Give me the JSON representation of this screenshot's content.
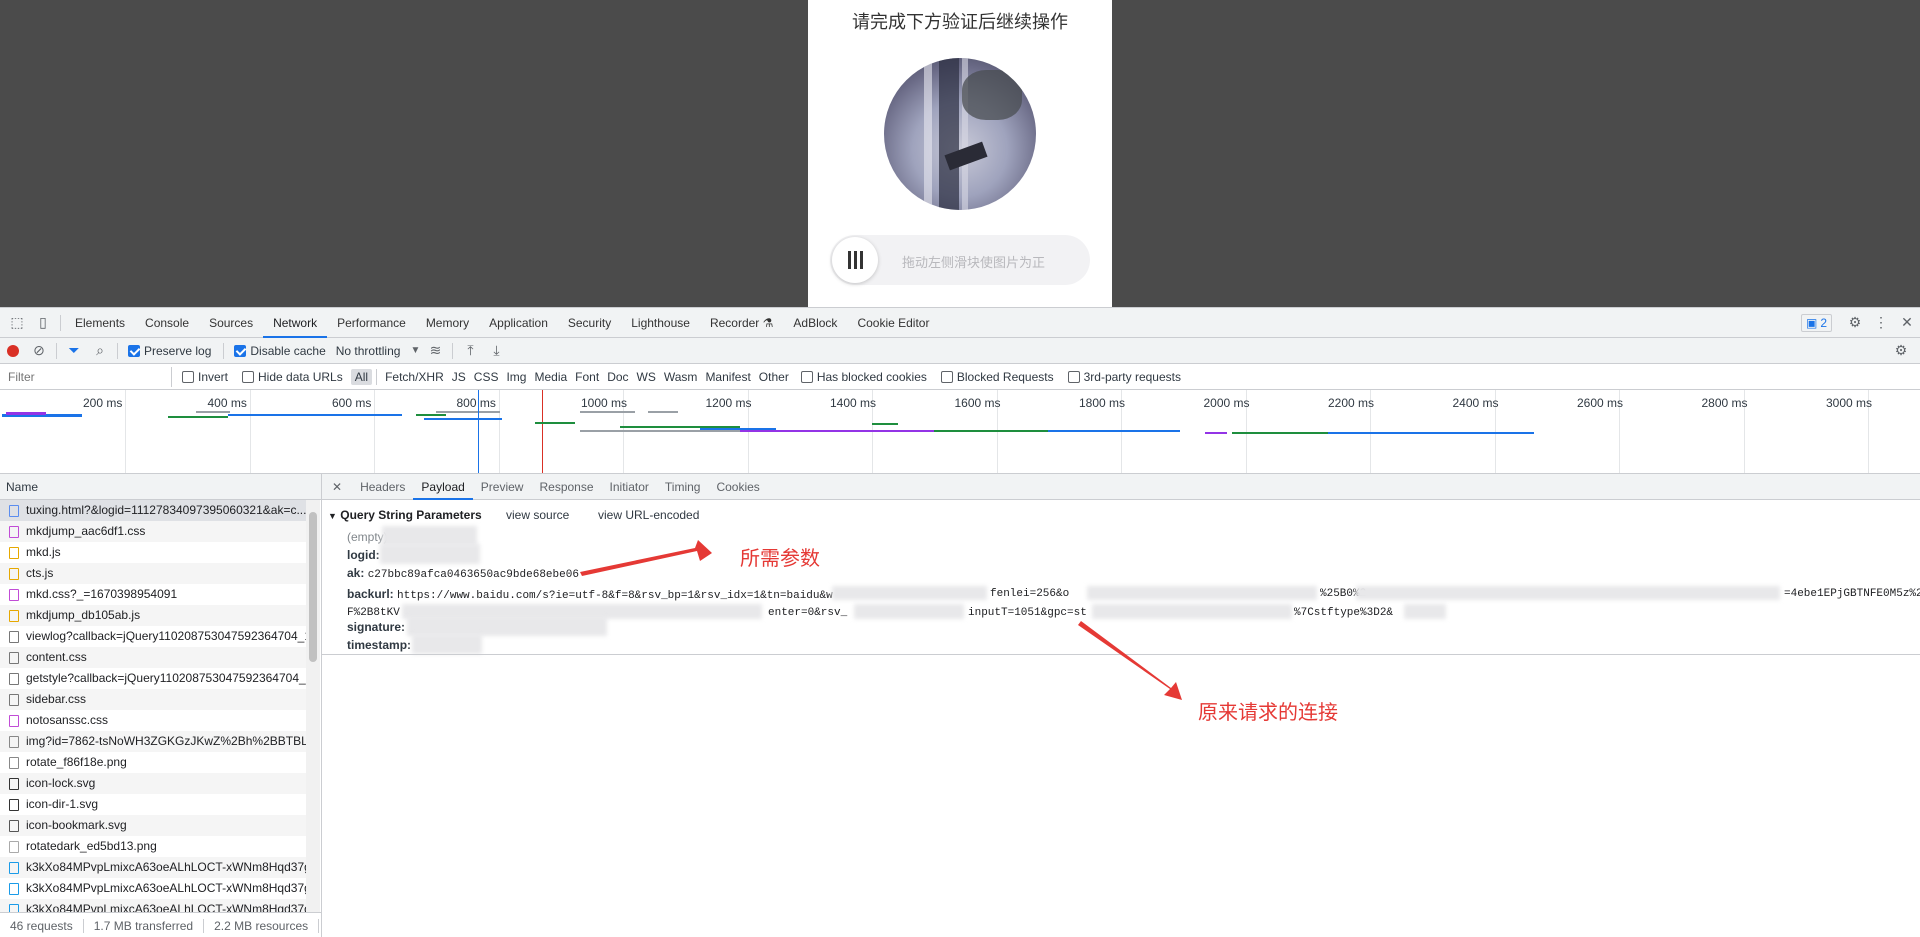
{
  "captcha": {
    "title": "请完成下方验证后继续操作",
    "slider_hint": "拖动左侧滑块使图片为正"
  },
  "devtools": {
    "main_tabs": [
      "Elements",
      "Console",
      "Sources",
      "Network",
      "Performance",
      "Memory",
      "Application",
      "Security",
      "Lighthouse",
      "Recorder ⚗",
      "AdBlock",
      "Cookie Editor"
    ],
    "active_tab": "Network",
    "issues_count": "2",
    "toolbar": {
      "preserve_log": "Preserve log",
      "disable_cache": "Disable cache",
      "throttling": "No throttling"
    },
    "filter": {
      "placeholder": "Filter",
      "invert": "Invert",
      "hide_data_urls": "Hide data URLs",
      "types": [
        "All",
        "Fetch/XHR",
        "JS",
        "CSS",
        "Img",
        "Media",
        "Font",
        "Doc",
        "WS",
        "Wasm",
        "Manifest",
        "Other"
      ],
      "has_blocked_cookies": "Has blocked cookies",
      "blocked_requests": "Blocked Requests",
      "third_party": "3rd-party requests"
    },
    "timeline_ticks": [
      "200 ms",
      "400 ms",
      "600 ms",
      "800 ms",
      "1000 ms",
      "1200 ms",
      "1400 ms",
      "1600 ms",
      "1800 ms",
      "2000 ms",
      "2200 ms",
      "2400 ms",
      "2600 ms",
      "2800 ms",
      "3000 ms"
    ],
    "name_header": "Name",
    "requests": [
      "tuxing.html?&logid=11127834097395060321&ak=c...",
      "mkdjump_aac6df1.css",
      "mkd.js",
      "cts.js",
      "mkd.css?_=1670398954091",
      "mkdjump_db105ab.js",
      "viewlog?callback=jQuery110208753047592364704_1...",
      "content.css",
      "getstyle?callback=jQuery110208753047592364704_1...",
      "sidebar.css",
      "notosanssc.css",
      "img?id=7862-tsNoWH3ZGKGzJKwZ%2Bh%2BBTBLa9...",
      "rotate_f86f18e.png",
      "icon-lock.svg",
      "icon-dir-1.svg",
      "icon-bookmark.svg",
      "rotatedark_ed5bd13.png",
      "k3kXo84MPvpLmixcA63oeALhLOCT-xWNm8Hqd37g...",
      "k3kXo84MPvpLmixcA63oeALhLOCT-xWNm8Hqd37g...",
      "k3kXo84MPvpLmixcA63oeALhLOCT-xWNm8Hqd37g..."
    ],
    "status": {
      "requests": "46 requests",
      "transferred": "1.7 MB transferred",
      "resources": "2.2 MB resources"
    },
    "detail_tabs": [
      "Headers",
      "Payload",
      "Preview",
      "Response",
      "Initiator",
      "Timing",
      "Cookies"
    ],
    "active_detail_tab": "Payload",
    "payload": {
      "section_title": "Query String Parameters",
      "view_source": "view source",
      "view_url_encoded": "view URL-encoded",
      "empty": "(empty)",
      "params": [
        {
          "key": "logid:",
          "value": ""
        },
        {
          "key": "ak:",
          "value": "c27bbc89afca0463650ac9bde68ebe06"
        },
        {
          "key": "backurl:",
          "value": "https://www.baidu.com/s?ie=utf-8&f=8&rsv_bp=1&rsv_idx=1&tn=baidu&w",
          "value_cont": "fenlei=256&o",
          "value_cont2": "%25B0%2",
          "value_cont3": "=4ebe1EPjGBTNFE0M5z%2"
        },
        {
          "key": "signature:",
          "value": ""
        },
        {
          "key": "timestamp:",
          "value": ""
        }
      ],
      "backurl_line2": {
        "a": "F%2B8tKV",
        "b": "enter=0&rsv_",
        "c": "inputT=1051&gpc=st",
        "d": "%7Cstftype%3D2&"
      }
    }
  },
  "annotations": {
    "param_note": "所需参数",
    "link_note": "原来请求的连接"
  }
}
